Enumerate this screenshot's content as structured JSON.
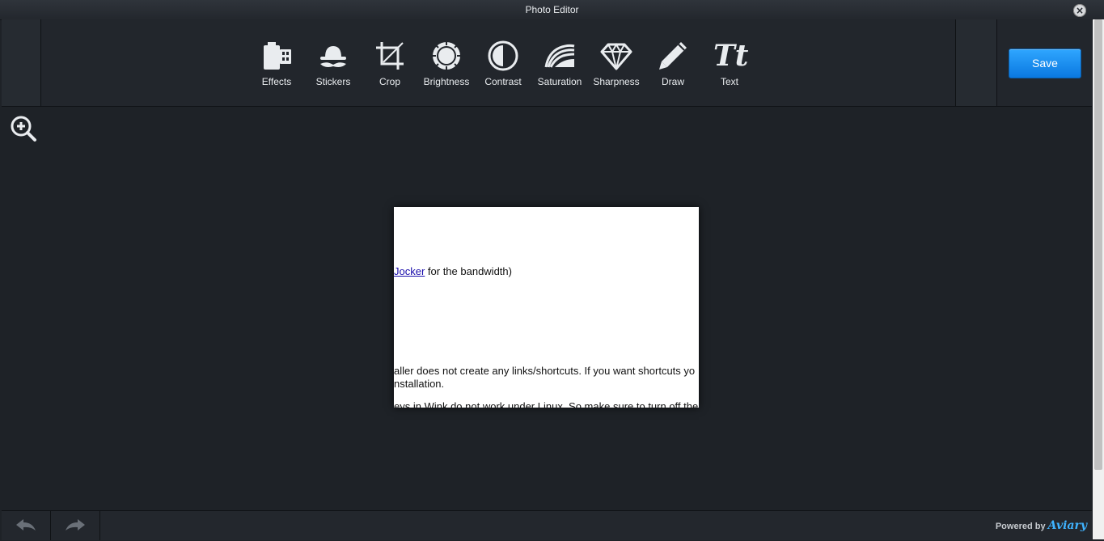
{
  "window": {
    "title": "Photo Editor",
    "close_glyph": "×"
  },
  "toolbar": {
    "tools": [
      {
        "label": "Effects",
        "icon": "film-icon"
      },
      {
        "label": "Stickers",
        "icon": "mustache-hat-icon"
      },
      {
        "label": "Crop",
        "icon": "crop-icon"
      },
      {
        "label": "Brightness",
        "icon": "sun-icon"
      },
      {
        "label": "Contrast",
        "icon": "contrast-icon"
      },
      {
        "label": "Saturation",
        "icon": "saturation-icon"
      },
      {
        "label": "Sharpness",
        "icon": "diamond-icon"
      },
      {
        "label": "Draw",
        "icon": "pencil-icon"
      },
      {
        "label": "Text",
        "icon": "text-icon"
      }
    ],
    "save_label": "Save"
  },
  "canvas": {
    "link_text": "Jocker",
    "line1_rest": " for the bandwidth)",
    "line2": "aller does not create any links/shortcuts. If you want shortcuts yo",
    "line3": "nstallation.",
    "line4": "eys in Wink do not work under Linux. So make sure to turn off the"
  },
  "footer": {
    "powered_by": "Powered by",
    "brand": "Aviary"
  },
  "colors": {
    "accent": "#1a8ef5",
    "background": "#1e2227",
    "toolbar": "#22262c"
  }
}
